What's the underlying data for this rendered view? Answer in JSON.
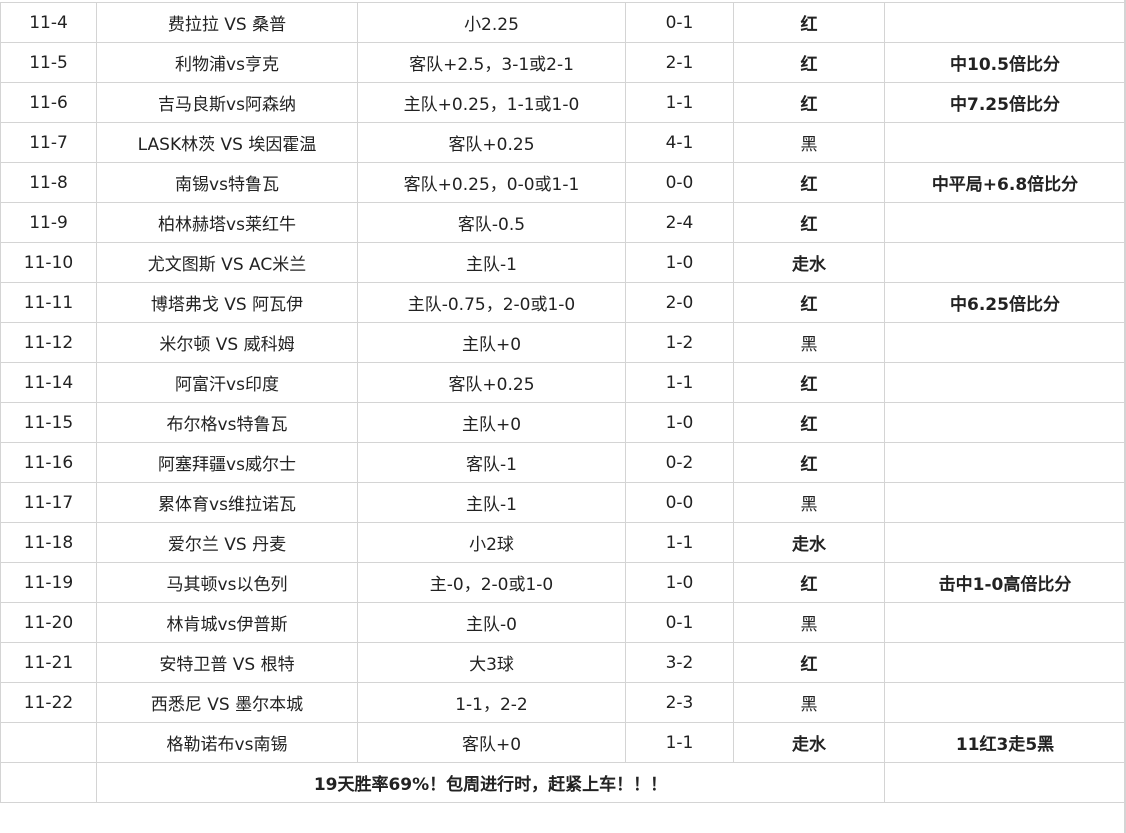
{
  "colors": {
    "score": "#e8141b",
    "red": "#ff0000",
    "push": "#1aa3e3",
    "black": "#222222",
    "grid": "#d4d4d4"
  },
  "rows": [
    {
      "date": "11-4",
      "match": "费拉拉 VS 桑普",
      "pick": "小2.25",
      "score": "0-1",
      "result": "红",
      "result_type": "red",
      "note": ""
    },
    {
      "date": "11-5",
      "match": "利物浦vs亨克",
      "pick": "客队+2.5，3-1或2-1",
      "score": "2-1",
      "result": "红",
      "result_type": "red",
      "note": "中10.5倍比分"
    },
    {
      "date": "11-6",
      "match": "吉马良斯vs阿森纳",
      "pick": "主队+0.25，1-1或1-0",
      "score": "1-1",
      "result": "红",
      "result_type": "red",
      "note": "中7.25倍比分"
    },
    {
      "date": "11-7",
      "match": "LASK林茨 VS 埃因霍温",
      "pick": "客队+0.25",
      "score": "4-1",
      "result": "黑",
      "result_type": "black",
      "note": ""
    },
    {
      "date": "11-8",
      "match": "南锡vs特鲁瓦",
      "pick": "客队+0.25，0-0或1-1",
      "score": "0-0",
      "result": "红",
      "result_type": "red",
      "note": "中平局+6.8倍比分"
    },
    {
      "date": "11-9",
      "match": "柏林赫塔vs莱红牛",
      "pick": "客队-0.5",
      "score": "2-4",
      "result": "红",
      "result_type": "red",
      "note": ""
    },
    {
      "date": "11-10",
      "match": "尤文图斯 VS AC米兰",
      "pick": "主队-1",
      "score": "1-0",
      "result": "走水",
      "result_type": "push",
      "note": ""
    },
    {
      "date": "11-11",
      "match": "博塔弗戈 VS 阿瓦伊",
      "pick": "主队-0.75，2-0或1-0",
      "score": "2-0",
      "result": "红",
      "result_type": "red",
      "note": "中6.25倍比分"
    },
    {
      "date": "11-12",
      "match": "米尔顿 VS 威科姆",
      "pick": "主队+0",
      "score": "1-2",
      "result": "黑",
      "result_type": "black",
      "note": ""
    },
    {
      "date": "11-14",
      "match": "阿富汗vs印度",
      "pick": "客队+0.25",
      "score": "1-1",
      "result": "红",
      "result_type": "red",
      "note": ""
    },
    {
      "date": "11-15",
      "match": "布尔格vs特鲁瓦",
      "pick": "主队+0",
      "score": "1-0",
      "result": "红",
      "result_type": "red",
      "note": ""
    },
    {
      "date": "11-16",
      "match": "阿塞拜疆vs威尔士",
      "pick": "客队-1",
      "score": "0-2",
      "result": "红",
      "result_type": "red",
      "note": ""
    },
    {
      "date": "11-17",
      "match": "累体育vs维拉诺瓦",
      "pick": "主队-1",
      "score": "0-0",
      "result": "黑",
      "result_type": "black",
      "note": ""
    },
    {
      "date": "11-18",
      "match": "爱尔兰 VS 丹麦",
      "pick": "小2球",
      "score": "1-1",
      "result": "走水",
      "result_type": "push",
      "note": ""
    },
    {
      "date": "11-19",
      "match": "马其顿vs以色列",
      "pick": "主-0，2-0或1-0",
      "score": "1-0",
      "result": "红",
      "result_type": "red",
      "note": "击中1-0高倍比分"
    },
    {
      "date": "11-20",
      "match": "林肯城vs伊普斯",
      "pick": "主队-0",
      "score": "0-1",
      "result": "黑",
      "result_type": "black",
      "note": ""
    },
    {
      "date": "11-21",
      "match": "安特卫普 VS 根特",
      "pick": "大3球",
      "score": "3-2",
      "result": "红",
      "result_type": "red",
      "note": ""
    },
    {
      "date": "11-22",
      "match": "西悉尼 VS 墨尔本城",
      "pick": "1-1，2-2",
      "score": "2-3",
      "result": "黑",
      "result_type": "black",
      "note": ""
    },
    {
      "date": "",
      "match": "格勒诺布vs南锡",
      "pick": "客队+0",
      "score": "1-1",
      "result": "走水",
      "result_type": "push",
      "note": "11红3走5黑"
    }
  ],
  "footer": {
    "text": "19天胜率69%！包周进行时，赶紧上车！！！"
  }
}
